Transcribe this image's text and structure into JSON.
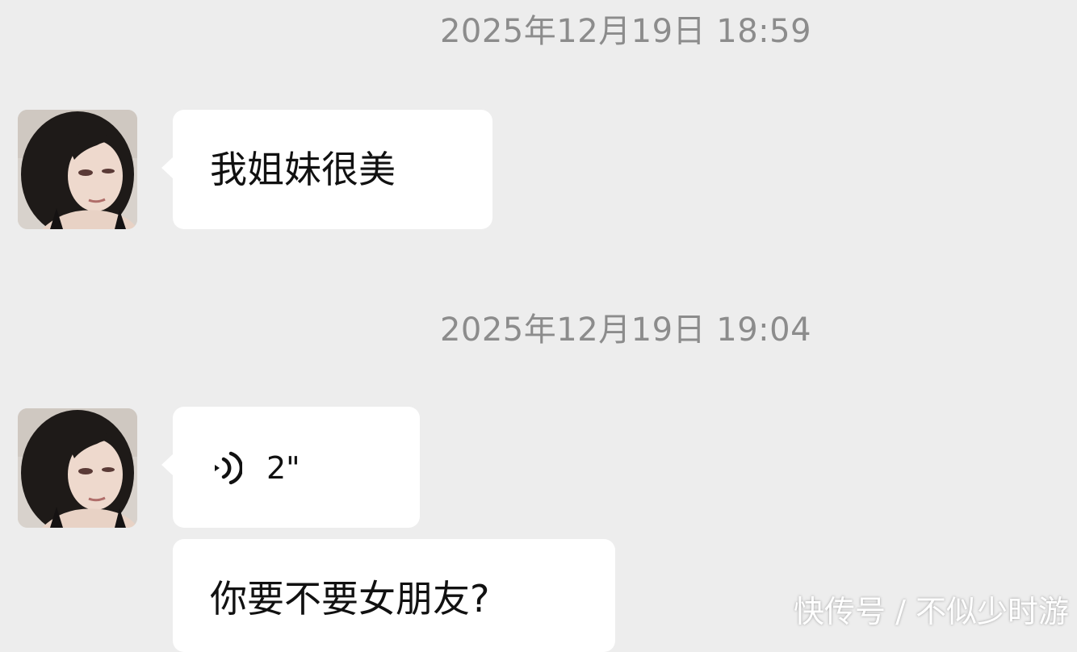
{
  "messages": [
    {
      "timestamp": "2025年12月19日 18:59",
      "text": "我姐妹很美"
    },
    {
      "timestamp": "2025年12月19日 19:04",
      "voice_duration": "2\"",
      "text": "你要不要女朋友?"
    }
  ],
  "watermark": "快传号 / 不似少时游",
  "colors": {
    "background": "#ededed",
    "bubble": "#ffffff",
    "timestamp_text": "#8c8c8c",
    "message_text": "#111111"
  },
  "icons": {
    "voice": "voice-wave-icon",
    "avatar": "avatar-photo"
  }
}
